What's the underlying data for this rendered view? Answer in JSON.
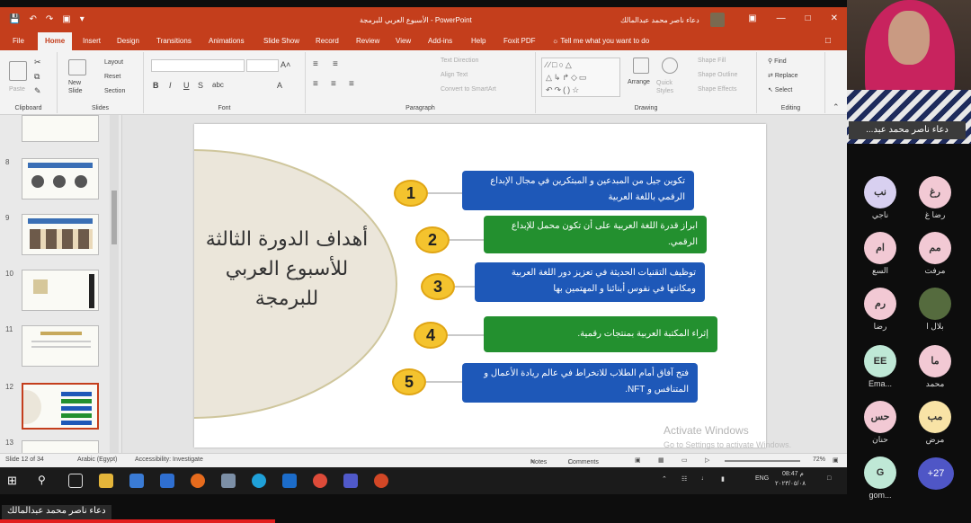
{
  "window": {
    "doc_title": "الأسبوع العربي للبرمجة  -  PowerPoint",
    "user_name": "دعاء ناصر محمد عبدالمالك"
  },
  "tabs": [
    "File",
    "Home",
    "Insert",
    "Design",
    "Transitions",
    "Animations",
    "Slide Show",
    "Record",
    "Review",
    "View",
    "Add-ins",
    "Help",
    "Foxit PDF"
  ],
  "tell_me": "Tell me what you want to do",
  "ribbon": {
    "clipboard": {
      "paste": "Paste",
      "label": "Clipboard"
    },
    "slides": {
      "new_slide": "New Slide",
      "layout": "Layout",
      "reset": "Reset",
      "section": "Section",
      "label": "Slides"
    },
    "font": {
      "label": "Font"
    },
    "paragraph": {
      "text_direction": "Text Direction",
      "align_text": "Align Text",
      "smartart": "Convert to SmartArt",
      "label": "Paragraph"
    },
    "drawing": {
      "arrange": "Arrange",
      "quick_styles": "Quick Styles",
      "shape_fill": "Shape Fill",
      "shape_outline": "Shape Outline",
      "shape_effects": "Shape Effects",
      "label": "Drawing"
    },
    "editing": {
      "find": "Find",
      "replace": "Replace",
      "select": "Select",
      "label": "Editing"
    }
  },
  "thumbnails": {
    "numbers": [
      "8",
      "9",
      "10",
      "11",
      "12",
      "13"
    ]
  },
  "slide": {
    "title": "أهداف الدورة الثالثة للأسبوع العربي للبرمجة",
    "goals": [
      {
        "num": "1",
        "text": "تكوين جيل من المبدعين و المبتكرين في مجال الإبداع الرقمي باللغة العربية"
      },
      {
        "num": "2",
        "text": "ابراز قدرة اللغة العربية على أن تكون محمل للإبداع الرقمي."
      },
      {
        "num": "3",
        "text": "توظيف التقنيات الحديثة في تعزيز دور اللغة العربية ومكانتها في نفوس أبنائنا و المهتمين بها"
      },
      {
        "num": "4",
        "text": "إثراء المكتبة العربية بمنتجات رقمية."
      },
      {
        "num": "5",
        "text": "فتح آفاق أمام الطلاب للانخراط في عالم ريادة الأعمال و المتنافس و NFT."
      }
    ],
    "watermark_title": "Activate Windows",
    "watermark_sub": "Go to Settings to activate Windows."
  },
  "status": {
    "slide_count": "Slide 12 of 34",
    "language": "Arabic (Egypt)",
    "accessibility": "Accessibility: Investigate",
    "notes": "Notes",
    "comments": "Comments",
    "zoom": "72%"
  },
  "taskbar": {
    "lang": "ENG",
    "time": "08:47 م",
    "date": "٢٠٢٣/٠٥/٠٨"
  },
  "meeting": {
    "presenter_name": "دعاء ناصر محمد عبد...",
    "presenter_tag": "دعاء ناصر محمد عبدالمالك",
    "participants": [
      {
        "initials": "رغ",
        "name": "رضا غ",
        "color": "#f2c9d4"
      },
      {
        "initials": "نب",
        "name": "ناجي",
        "color": "#d8d0f0"
      },
      {
        "initials": "مم",
        "name": "مرفت",
        "color": "#f2c9d4"
      },
      {
        "initials": "ام",
        "name": "السع",
        "color": "#f2c9d4"
      },
      {
        "initials": "",
        "name": "بلال ا",
        "color": "#556b3e"
      },
      {
        "initials": "رم",
        "name": "رضا",
        "color": "#f2c9d4"
      },
      {
        "initials": "ما",
        "name": "محمد",
        "color": "#f2c9d4"
      },
      {
        "initials": "EE",
        "name": "Ema...",
        "color": "#bfe8d6"
      },
      {
        "initials": "مب",
        "name": "مرض",
        "color": "#f8e3a6"
      },
      {
        "initials": "حس",
        "name": "حنان",
        "color": "#f2c9d4"
      },
      {
        "initials": "G",
        "name": "gom...",
        "color": "#bfe8d6"
      }
    ],
    "more": "+27"
  }
}
